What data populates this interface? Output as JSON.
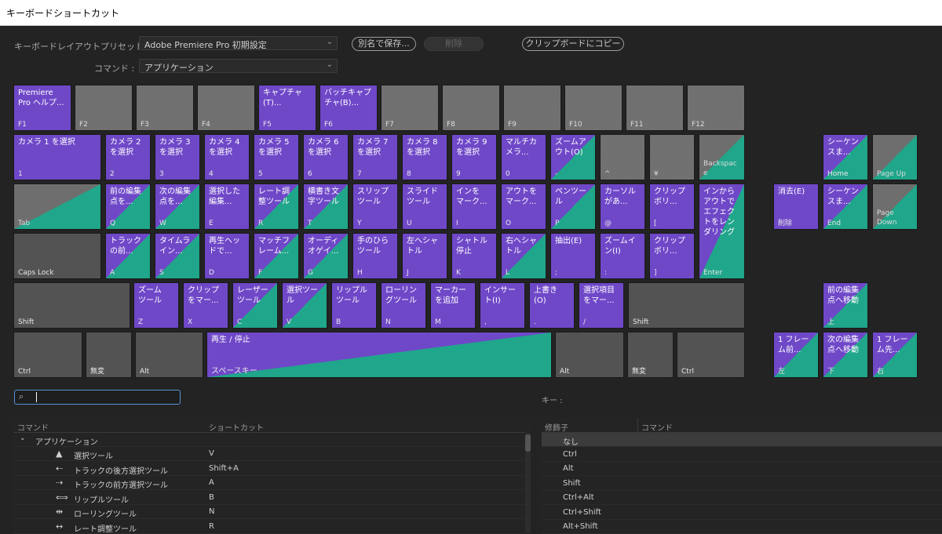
{
  "window": {
    "title": "キーボードショートカット"
  },
  "toolbar": {
    "layout_label": "キーボードレイアウトプリセット :",
    "layout_value": "Adobe Premiere Pro 初期設定",
    "save_as_label": "別名で保存...",
    "delete_label": "削除",
    "copy_label": "クリップボードにコピー",
    "command_label": "コマンド :",
    "command_value": "アプリケーション"
  },
  "legend_colors": {
    "app_command": "#6f48c8",
    "panel_command": "#20a68a",
    "unassigned": "#6e6e6e"
  },
  "keyboard": {
    "f1": {
      "cmd": "Premiere\nPro ヘルプ...",
      "key": "F1"
    },
    "f2": {
      "key": "F2"
    },
    "f3": {
      "key": "F3"
    },
    "f4": {
      "key": "F4"
    },
    "f5": {
      "cmd": "キャプチャ\n(T)...",
      "key": "F5"
    },
    "f6": {
      "cmd": "バッチキャプ\nチャ(B)...",
      "key": "F6"
    },
    "f7": {
      "key": "F7"
    },
    "f8": {
      "key": "F8"
    },
    "f9": {
      "key": "F9"
    },
    "f10": {
      "key": "F10"
    },
    "f11": {
      "key": "F11"
    },
    "f12": {
      "key": "F12"
    },
    "k1": {
      "cmd": "カメラ 1 を選択",
      "key": "1"
    },
    "k2": {
      "cmd": "カメラ 2\nを選択",
      "key": "2"
    },
    "k3": {
      "cmd": "カメラ 3\nを選択",
      "key": "3"
    },
    "k4": {
      "cmd": "カメラ 4\nを選択",
      "key": "4"
    },
    "k5": {
      "cmd": "カメラ 5\nを選択",
      "key": "5"
    },
    "k6": {
      "cmd": "カメラ 6\nを選択",
      "key": "6"
    },
    "k7": {
      "cmd": "カメラ 7\nを選択",
      "key": "7"
    },
    "k8": {
      "cmd": "カメラ 8\nを選択",
      "key": "8"
    },
    "k9": {
      "cmd": "カメラ 9\nを選択",
      "key": "9"
    },
    "k0": {
      "cmd": "マルチカ\nメラ...",
      "key": "0"
    },
    "kminus": {
      "cmd": "ズームア\nウト(O)",
      "key": "-"
    },
    "kcaret": {
      "key": "^"
    },
    "kyen": {
      "key": "¥"
    },
    "backspace": {
      "key": "Backspac\ne"
    },
    "tab": {
      "key": "Tab"
    },
    "q": {
      "cmd": "前の編集\n点を...",
      "key": "Q"
    },
    "w": {
      "cmd": "次の編集\n点を...",
      "key": "W"
    },
    "e": {
      "cmd": "選択した\n編集...",
      "key": "E"
    },
    "r": {
      "cmd": "レート調\n整ツール",
      "key": "R"
    },
    "tk": {
      "cmd": "横書き文\n字ツール",
      "key": "T"
    },
    "y": {
      "cmd": "スリップ\nツール",
      "key": "Y"
    },
    "u": {
      "cmd": "スライド\nツール",
      "key": "U"
    },
    "i": {
      "cmd": "インを\nマーク...",
      "key": "I"
    },
    "o": {
      "cmd": "アウトを\nマーク...",
      "key": "O"
    },
    "p": {
      "cmd": "ペンツー\nル",
      "key": "P"
    },
    "at": {
      "cmd": "カーソル\nがあ...",
      "key": "@"
    },
    "lbracket": {
      "cmd": "クリップ\nボリ...",
      "key": "["
    },
    "enter": {
      "cmd": "インから\nアウトで\nエフェク\nトをレン\nダリング",
      "key": "Enter"
    },
    "capslock": {
      "key": "Caps Lock"
    },
    "a": {
      "cmd": "トラック\nの前...",
      "key": "A"
    },
    "s": {
      "cmd": "タイムラ\nイン...",
      "key": "S"
    },
    "d": {
      "cmd": "再生ヘッ\nドで...",
      "key": "D"
    },
    "f": {
      "cmd": "マッチフ\nレーム...",
      "key": "F"
    },
    "g": {
      "cmd": "オーディ\nオゲイ...",
      "key": "G"
    },
    "h": {
      "cmd": "手のひら\nツール",
      "key": "H"
    },
    "j": {
      "cmd": "左へシャ\nトル",
      "key": "J"
    },
    "k": {
      "cmd": "シャトル\n停止",
      "key": "K"
    },
    "l": {
      "cmd": "右へシャ\nトル",
      "key": "L"
    },
    "semicolon": {
      "cmd": "抽出(E)",
      "key": ";"
    },
    "colon": {
      "cmd": "ズームイ\nン(I)",
      "key": ":"
    },
    "rbracket": {
      "cmd": "クリップ\nボリ...",
      "key": "]"
    },
    "lshift": {
      "key": "Shift"
    },
    "z": {
      "cmd": "ズーム\nツール",
      "key": "Z"
    },
    "x": {
      "cmd": "クリップ\nをマー...",
      "key": "X"
    },
    "c": {
      "cmd": "レーザー\nツール",
      "key": "C"
    },
    "v": {
      "cmd": "選択ツー\nル",
      "key": "V"
    },
    "b": {
      "cmd": "リップル\nツール",
      "key": "B"
    },
    "n": {
      "cmd": "ローリン\nグツール",
      "key": "N"
    },
    "m": {
      "cmd": "マーカー\nを追加",
      "key": "M"
    },
    "comma": {
      "cmd": "インサー\nト(I)",
      "key": ","
    },
    "period": {
      "cmd": "上書き\n(O)",
      "key": "."
    },
    "slash": {
      "cmd": "選択項目\nをマー...",
      "key": "/"
    },
    "rshift": {
      "key": "Shift"
    },
    "lctrl": {
      "key": "Ctrl"
    },
    "muhenkan": {
      "key": "無変"
    },
    "lalt": {
      "key": "Alt"
    },
    "space": {
      "cmd": "再生 / 停止",
      "key": "スペースキー"
    },
    "ralt": {
      "key": "Alt"
    },
    "henkan": {
      "key": "無変"
    },
    "rctrl": {
      "key": "Ctrl"
    },
    "delete": {
      "cmd": "消去(E)",
      "key": "削除"
    },
    "end": {
      "cmd": "シーケン\nスま...",
      "key": "End"
    },
    "pagedown": {
      "key": "Page\nDown"
    },
    "home": {
      "cmd": "シーケン\nスま...",
      "key": "Home"
    },
    "pageup": {
      "key": "Page Up"
    },
    "up": {
      "cmd": "前の編集\n点へ移動",
      "key": "上"
    },
    "left": {
      "cmd": "1 フレー\nム前...",
      "key": "左"
    },
    "down": {
      "cmd": "次の編集\n点へ移動",
      "key": "下"
    },
    "right": {
      "cmd": "1 フレー\nム先...",
      "key": "右"
    }
  },
  "search": {
    "placeholder": ""
  },
  "keys_panel": {
    "label": "キー :"
  },
  "command_table": {
    "col_command": "コマンド",
    "col_shortcut": "ショートカット",
    "group": "アプリケーション",
    "rows": [
      {
        "icon": "selection-tool-icon",
        "glyph": "▲",
        "name": "選択ツール",
        "shortcut": "V"
      },
      {
        "icon": "track-select-backward-icon",
        "glyph": "⇠",
        "name": "トラックの後方選択ツール",
        "shortcut": "Shift+A"
      },
      {
        "icon": "track-select-forward-icon",
        "glyph": "⇢",
        "name": "トラックの前方選択ツール",
        "shortcut": "A"
      },
      {
        "icon": "ripple-edit-icon",
        "glyph": "⟺",
        "name": "リップルツール",
        "shortcut": "B"
      },
      {
        "icon": "rolling-edit-icon",
        "glyph": "⇹",
        "name": "ローリングツール",
        "shortcut": "N"
      },
      {
        "icon": "rate-stretch-icon",
        "glyph": "↔",
        "name": "レート調整ツール",
        "shortcut": "R"
      }
    ]
  },
  "modifier_table": {
    "col_modifier": "修飾子",
    "col_command": "コマンド",
    "rows": [
      "なし",
      "Ctrl",
      "Alt",
      "Shift",
      "Ctrl+Alt",
      "Ctrl+Shift",
      "Alt+Shift"
    ]
  }
}
